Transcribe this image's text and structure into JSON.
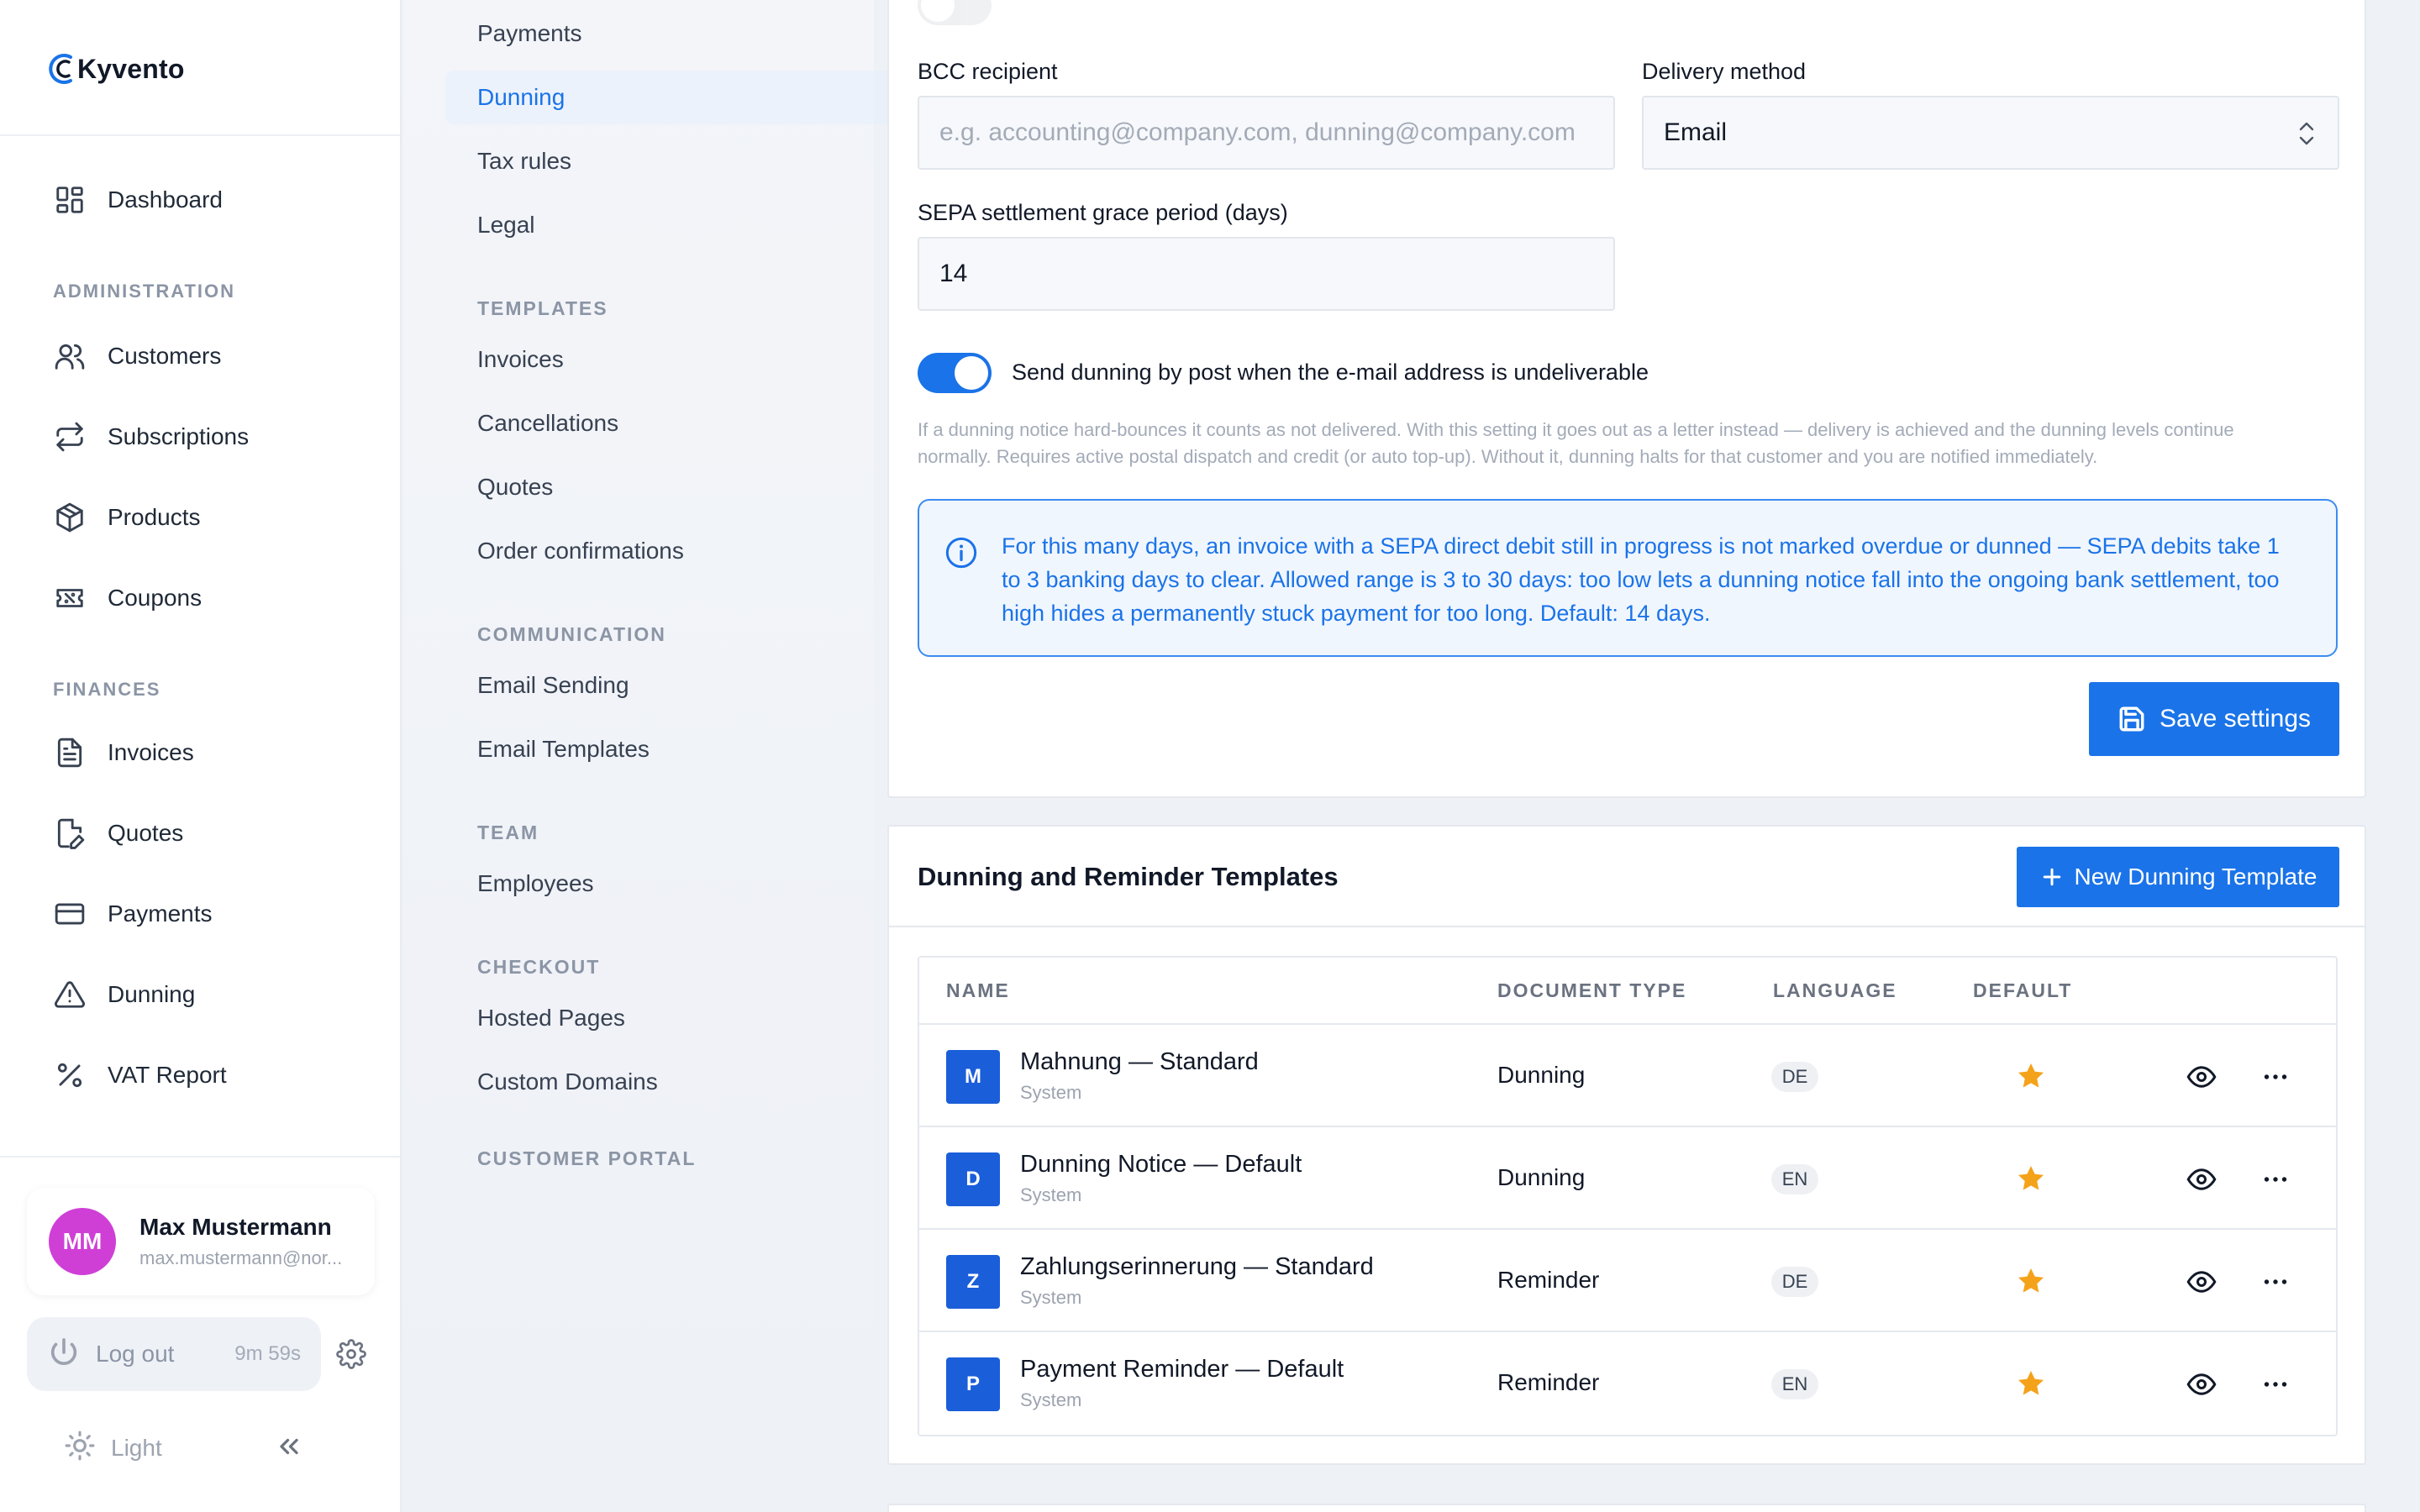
{
  "app": {
    "name": "Kyvento"
  },
  "sidebar": {
    "items": [
      {
        "label": "Dashboard",
        "icon": "dashboard-icon"
      },
      {
        "section": "ADMINISTRATION"
      },
      {
        "label": "Customers",
        "icon": "users-icon"
      },
      {
        "label": "Subscriptions",
        "icon": "repeat-icon"
      },
      {
        "label": "Products",
        "icon": "box-icon"
      },
      {
        "label": "Coupons",
        "icon": "ticket-icon"
      },
      {
        "section": "FINANCES"
      },
      {
        "label": "Invoices",
        "icon": "document-icon"
      },
      {
        "label": "Quotes",
        "icon": "edit-document-icon"
      },
      {
        "label": "Payments",
        "icon": "credit-card-icon"
      },
      {
        "label": "Dunning",
        "icon": "warning-icon"
      },
      {
        "label": "VAT Report",
        "icon": "percent-icon"
      }
    ],
    "user": {
      "initials": "MM",
      "name": "Max Mustermann",
      "email": "max.mustermann@nor..."
    },
    "logout": {
      "label": "Log out",
      "timer": "9m 59s"
    },
    "theme_label": "Light"
  },
  "subnav": {
    "items": [
      {
        "label": "Payments"
      },
      {
        "label": "Dunning",
        "active": true
      },
      {
        "label": "Tax rules"
      },
      {
        "label": "Legal"
      },
      {
        "section": "TEMPLATES"
      },
      {
        "label": "Invoices"
      },
      {
        "label": "Cancellations"
      },
      {
        "label": "Quotes"
      },
      {
        "label": "Order confirmations"
      },
      {
        "section": "COMMUNICATION"
      },
      {
        "label": "Email Sending"
      },
      {
        "label": "Email Templates"
      },
      {
        "section": "TEAM"
      },
      {
        "label": "Employees"
      },
      {
        "section": "CHECKOUT"
      },
      {
        "label": "Hosted Pages"
      },
      {
        "label": "Custom Domains"
      },
      {
        "section": "CUSTOMER PORTAL"
      }
    ]
  },
  "settings": {
    "bcc_label": "BCC recipient",
    "bcc_placeholder": "e.g. accounting@company.com, dunning@company.com",
    "delivery_label": "Delivery method",
    "delivery_value": "Email",
    "grace_label": "SEPA settlement grace period (days)",
    "grace_value": "14",
    "post_toggle_label": "Send dunning by post when the e-mail address is undeliverable",
    "post_toggle_on": true,
    "post_help": "If a dunning notice hard-bounces it counts as not delivered. With this setting it goes out as a letter instead — delivery is achieved and the dunning levels continue normally. Requires active postal dispatch and credit (or auto top-up). Without it, dunning halts for that customer and you are notified immediately.",
    "info_text": "For this many days, an invoice with a SEPA direct debit still in progress is not marked overdue or dunned — SEPA debits take 1 to 3 banking days to clear. Allowed range is 3 to 30 days: too low lets a dunning notice fall into the ongoing bank settlement, too high hides a permanently stuck payment for too long. Default: 14 days.",
    "save_label": "Save settings"
  },
  "templates": {
    "title": "Dunning and Reminder Templates",
    "new_button": "New Dunning Template",
    "columns": [
      "NAME",
      "DOCUMENT TYPE",
      "LANGUAGE",
      "DEFAULT"
    ],
    "rows": [
      {
        "initial": "M",
        "name": "Mahnung — Standard",
        "sub": "System",
        "type": "Dunning",
        "language": "DE",
        "default": true
      },
      {
        "initial": "D",
        "name": "Dunning Notice — Default",
        "sub": "System",
        "type": "Dunning",
        "language": "EN",
        "default": true
      },
      {
        "initial": "Z",
        "name": "Zahlungserinnerung — Standard",
        "sub": "System",
        "type": "Reminder",
        "language": "DE",
        "default": true
      },
      {
        "initial": "P",
        "name": "Payment Reminder — Default",
        "sub": "System",
        "type": "Reminder",
        "language": "EN",
        "default": true
      }
    ]
  },
  "colors": {
    "accent": "#1a73e8",
    "avatar": "#cf3fd6",
    "star": "#f5a21b"
  }
}
